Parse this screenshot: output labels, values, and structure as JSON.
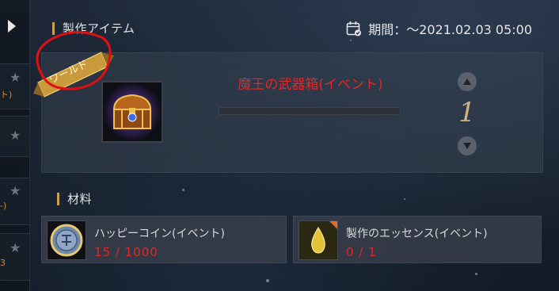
{
  "header": {
    "craft_item_title": "製作アイテム",
    "period_label": "期間：～2021.02.03  05:00"
  },
  "product": {
    "badge_label": "ワールド",
    "name": "魔王の武器箱(イベント)",
    "quantity": "1",
    "craft_progress": 0
  },
  "materials_section": {
    "title": "材料",
    "items": [
      {
        "name": "ハッピーコイン(イベント)",
        "count": "15 / 1000"
      },
      {
        "name": "製作のエッセンス(イベント)",
        "count": "0 / 1"
      }
    ]
  },
  "left_list": {
    "items": [
      {
        "text": "ト)"
      },
      {
        "text": ""
      },
      {
        "text": "-)"
      },
      {
        "text": "3"
      }
    ]
  },
  "colors": {
    "accent_gold": "#c8a24a",
    "shortage_red": "#e02828",
    "annotation_red": "#e01010",
    "badge_gold": "#c99a3b"
  },
  "icons": {
    "period": "calendar-check-icon",
    "qty_up": "triangle-up-icon",
    "qty_down": "triangle-down-icon",
    "product": "treasure-chest-icon",
    "material_1": "silver-coin-icon",
    "material_2": "golden-drop-icon"
  }
}
